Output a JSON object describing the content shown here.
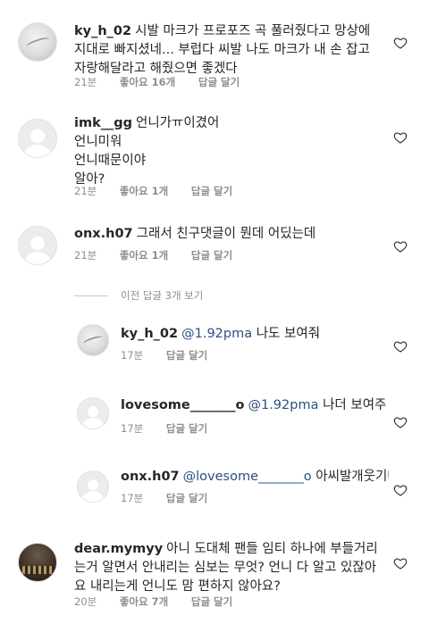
{
  "comments": [
    {
      "username": "ky_h_02",
      "text": "시발 마크가 프로포즈 곡 풀러줬다고 망상에 지대로 빠지셨네... 부럽다 씨발 나도 마크가 내 손 잡고 자랑해달라고 해줬으면 좋겠다",
      "time": "21분",
      "likes": "좋아요 16개",
      "reply": "답글 달기",
      "avatar": "photo-gray"
    },
    {
      "username": "imk__gg",
      "text": "언니가ㅠ이겼어\n언니미워\n언니때문이야\n알아?",
      "time": "21분",
      "likes": "좋아요 1개",
      "reply": "답글 달기",
      "avatar": "default"
    },
    {
      "username": "onx.h07",
      "text": "그래서 친구댓글이 뭔데 어딨는데",
      "time": "21분",
      "likes": "좋아요 1개",
      "reply": "답글 달기",
      "avatar": "default"
    }
  ],
  "view_previous_replies": "이전 답글 3개 보기",
  "replies": [
    {
      "username": "ky_h_02",
      "mention": "@1.92pma",
      "text": "나도 보여줘",
      "time": "17분",
      "reply": "답글 달기",
      "avatar": "photo-gray"
    },
    {
      "username": "lovesome_______o",
      "mention": "@1.92pma",
      "text": "나더 보여주 ㅓ",
      "time": "17분",
      "reply": "답글 달기",
      "avatar": "default"
    },
    {
      "username": "onx.h07",
      "mention": "@lovesome_______o",
      "text": "아씨발개웃기네",
      "time": "17분",
      "reply": "답글 달기",
      "avatar": "default"
    }
  ],
  "last_comment": {
    "username": "dear.mymyy",
    "text": "아니 도대체 팬들 임티 하나에 부들거리는거 알면서 안내리는 심보는 무엇? 언니 다 알고 있잖아요 내리는게 언니도 맘 편하지 않아요?",
    "time": "20분",
    "likes": "좋아요 7개",
    "reply": "답글 달기",
    "avatar": "photo-dark"
  },
  "icons": {
    "like": "heart-outline-icon"
  },
  "colors": {
    "text": "#262626",
    "meta": "#8e8e8e",
    "mention": "#2b4f83",
    "heart": "#262626"
  }
}
